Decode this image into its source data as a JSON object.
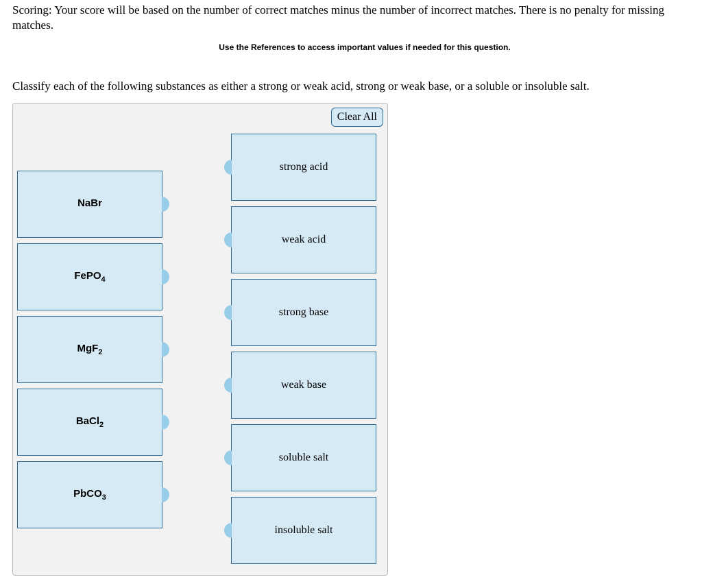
{
  "scoring_text": "Scoring: Your score will be based on the number of correct matches minus the number of incorrect matches. There is no penalty for missing matches.",
  "references_hint": "Use the References to access important values if needed for this question.",
  "question_text": "Classify each of the following substances as either a strong or weak acid, strong or weak base, or a soluble or insoluble salt.",
  "clear_all_label": "Clear All",
  "substances": [
    {
      "base": "NaBr",
      "sub": ""
    },
    {
      "base": "FePO",
      "sub": "4"
    },
    {
      "base": "MgF",
      "sub": "2"
    },
    {
      "base": "BaCl",
      "sub": "2"
    },
    {
      "base": "PbCO",
      "sub": "3"
    }
  ],
  "categories": [
    "strong acid",
    "weak acid",
    "strong base",
    "weak base",
    "soluble salt",
    "insoluble salt"
  ]
}
